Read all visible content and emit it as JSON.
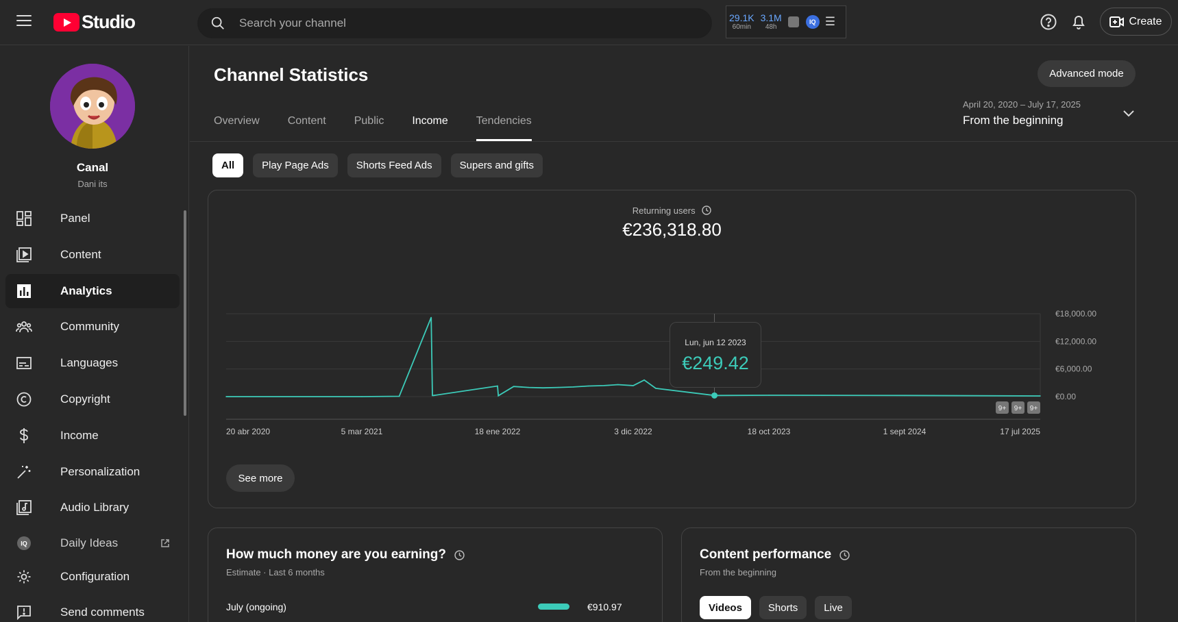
{
  "app": {
    "name": "Studio"
  },
  "search": {
    "placeholder": "Search your channel"
  },
  "stats_widget": {
    "stat1_value": "29.1K",
    "stat1_sub": "60min",
    "stat2_value": "3.1M",
    "stat2_sub": "48h",
    "badge": "IQ"
  },
  "header": {
    "create_label": "Create"
  },
  "channel": {
    "name": "Canal",
    "handle": "Dani its"
  },
  "sidebar": {
    "items": [
      {
        "label": "Panel",
        "icon": "dashboard-icon"
      },
      {
        "label": "Content",
        "icon": "content-icon"
      },
      {
        "label": "Analytics",
        "icon": "analytics-icon"
      },
      {
        "label": "Community",
        "icon": "community-icon"
      },
      {
        "label": "Languages",
        "icon": "subtitles-icon"
      },
      {
        "label": "Copyright",
        "icon": "copyright-icon"
      },
      {
        "label": "Income",
        "icon": "dollar-icon"
      },
      {
        "label": "Personalization",
        "icon": "magic-wand-icon"
      },
      {
        "label": "Audio Library",
        "icon": "audio-library-icon"
      },
      {
        "label": "Daily Ideas",
        "icon": "iq-icon"
      },
      {
        "label": "Configuration",
        "icon": "gear-icon"
      },
      {
        "label": "Send comments",
        "icon": "feedback-icon"
      }
    ]
  },
  "page": {
    "title": "Channel Statistics",
    "advanced_mode": "Advanced mode",
    "tabs": [
      "Overview",
      "Content",
      "Public",
      "Income",
      "Tendencies"
    ],
    "date_range": {
      "dates": "April 20, 2020 – July 17, 2025",
      "label": "From the beginning"
    },
    "chips": [
      "All",
      "Play Page Ads",
      "Shorts Feed Ads",
      "Supers and gifts"
    ]
  },
  "main_chart": {
    "metric_label": "Returning users",
    "metric_value": "€236,318.80",
    "tooltip_date": "Lun, jun 12 2023",
    "tooltip_value": "€249.42",
    "see_more": "See more",
    "badges": [
      "9+",
      "9+",
      "9+"
    ]
  },
  "chart_data": {
    "type": "line",
    "title": "",
    "xlabel": "",
    "ylabel": "",
    "x_ticks": [
      "20 abr 2020",
      "5 mar 2021",
      "18 ene 2022",
      "3 dic 2022",
      "18 oct 2023",
      "1 sept 2024",
      "17 jul 2025"
    ],
    "y_ticks": [
      "€18,000.00",
      "€12,000.00",
      "€6,000.00",
      "€0.00"
    ],
    "ylim": [
      0,
      18000
    ],
    "x_range": [
      "2020-04-20",
      "2025-07-17"
    ],
    "series": [
      {
        "color": "#3ccbb9",
        "x": [
          "2020-04-20",
          "2021-03-05",
          "2021-06-01",
          "2021-08-15",
          "2021-08-18",
          "2021-08-21",
          "2022-01-18",
          "2022-01-20",
          "2022-02-25",
          "2022-04-01",
          "2022-05-05",
          "2022-06-10",
          "2022-07-15",
          "2022-08-20",
          "2022-09-25",
          "2022-10-28",
          "2022-12-03",
          "2022-12-29",
          "2023-01-25",
          "2023-06-12",
          "2023-10-18",
          "2024-09-01",
          "2025-07-17"
        ],
        "values": [
          0,
          0,
          80,
          17200,
          250,
          250,
          2300,
          200,
          2200,
          2000,
          1900,
          2000,
          2100,
          2300,
          2400,
          2600,
          2400,
          3600,
          1800,
          249.42,
          300,
          250,
          150
        ]
      }
    ],
    "hover_point": {
      "x": "2023-06-12",
      "y": 249.42
    }
  },
  "earnings_card": {
    "title": "How much money are you earning?",
    "subtitle": "Estimate · Last 6 months",
    "row_label": "July (ongoing)",
    "row_value": "€910.97"
  },
  "performance_card": {
    "title": "Content performance",
    "subtitle": "From the beginning",
    "chips": [
      "Videos",
      "Shorts",
      "Live"
    ]
  },
  "colors": {
    "accent": "#3ccbb9",
    "background": "#282828",
    "brand_red": "#ff0033"
  }
}
